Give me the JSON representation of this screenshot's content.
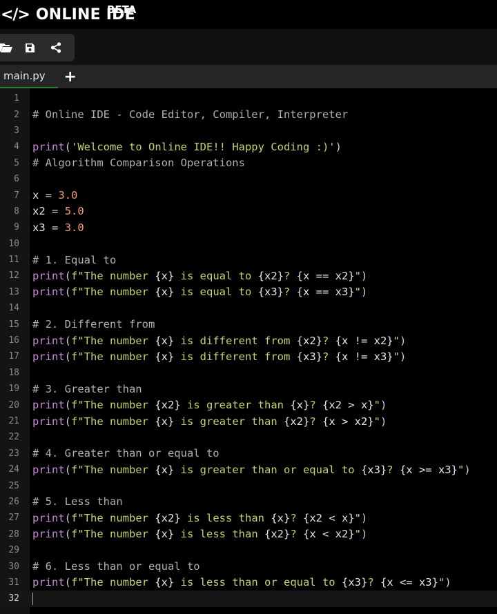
{
  "header": {
    "logo_glyph": "</>",
    "title": "ONLINE IDE",
    "badge": "BETA"
  },
  "toolbar": {
    "icons": [
      "folder-open-icon",
      "save-icon",
      "share-icon"
    ]
  },
  "tabs": [
    {
      "label": "main.py",
      "active": true
    }
  ],
  "tab_add_label": "+",
  "editor": {
    "active_line": 32,
    "colors": {
      "comment": "#b0b0b0",
      "function": "#c48ad6",
      "string": "#c3d36e",
      "number": "#f29d74",
      "tab_underline": "#2e7d32"
    },
    "lines": [
      "",
      "# Online IDE - Code Editor, Compiler, Interpreter",
      "",
      "print('Welcome to Online IDE!! Happy Coding :)')",
      "# Algorithm Comparison Operations",
      "",
      "x = 3.0",
      "x2 = 5.0",
      "x3 = 3.0",
      "",
      "# 1. Equal to",
      "print(f\"The number {x} is equal to {x2}? {x == x2}\")",
      "print(f\"The number {x} is equal to {x3}? {x == x3}\")",
      "",
      "# 2. Different from",
      "print(f\"The number {x} is different from {x2}? {x != x2}\")",
      "print(f\"The number {x} is different from {x3}? {x != x3}\")",
      "",
      "# 3. Greater than",
      "print(f\"The number {x2} is greater than {x}? {x2 > x}\")",
      "print(f\"The number {x} is greater than {x2}? {x > x2}\")",
      "",
      "# 4. Greater than or equal to",
      "print(f\"The number {x} is greater than or equal to {x3}? {x >= x3}\")",
      "",
      "# 5. Less than",
      "print(f\"The number {x2} is less than {x}? {x2 < x}\")",
      "print(f\"The number {x} is less than {x2}? {x < x2}\")",
      "",
      "# 6. Less than or equal to",
      "print(f\"The number {x} is less than or equal to {x3}? {x <= x3}\")",
      ""
    ]
  }
}
